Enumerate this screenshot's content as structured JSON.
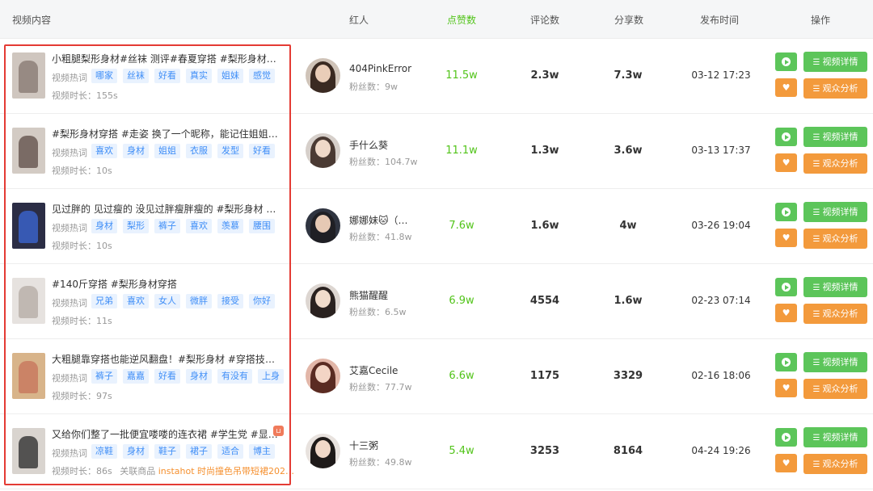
{
  "header": {
    "video": "视频内容",
    "influencer": "红人",
    "likes": "点赞数",
    "comments": "评论数",
    "shares": "分享数",
    "time": "发布时间",
    "ops": "操作"
  },
  "labels": {
    "keywords": "视频热词",
    "duration_prefix": "视频时长：",
    "fans_prefix": "粉丝数：",
    "product_label": "关联商品",
    "detail_btn": "视频详情",
    "analysis_btn": "观众分析"
  },
  "icons": {
    "play": "play-icon",
    "heart": "heart-icon",
    "list": "list-icon",
    "shop": "shopping-bag-icon"
  },
  "colors": {
    "green": "#5cc55a",
    "orange": "#f39a3c",
    "tag_blue": "#3f8ef7",
    "highlight": "#e43b34"
  },
  "rows": [
    {
      "title": "小粗腿梨形身材#丝袜 测评#春夏穿搭 #梨形身材穿搭…",
      "tags": [
        "哪家",
        "丝袜",
        "好看",
        "真实",
        "姐妹",
        "感觉"
      ],
      "duration": "155s",
      "influencer": "404PinkError",
      "fans": "9w",
      "likes": "11.5w",
      "comments": "2.3w",
      "shares": "7.3w",
      "time": "03-12 17:23"
    },
    {
      "title": "#梨形身材穿搭 #走姿 换了一个昵称，能记住姐姐了…",
      "tags": [
        "喜欢",
        "身材",
        "姐姐",
        "衣服",
        "发型",
        "好看"
      ],
      "duration": "10s",
      "influencer": "手什么葵",
      "fans": "104.7w",
      "likes": "11.1w",
      "comments": "1.3w",
      "shares": "3.6w",
      "time": "03-13 17:37"
    },
    {
      "title": "见过胖的 见过瘦的 没见过胖瘦胖瘦的 #梨形身材 #梨…",
      "tags": [
        "身材",
        "梨形",
        "裤子",
        "喜欢",
        "羡慕",
        "腰围"
      ],
      "duration": "10s",
      "influencer": "娜娜妹🐱（…",
      "fans": "41.8w",
      "likes": "7.6w",
      "comments": "1.6w",
      "shares": "4w",
      "time": "03-26 19:04"
    },
    {
      "title": "#140斤穿搭 #梨形身材穿搭",
      "tags": [
        "兄弟",
        "喜欢",
        "女人",
        "微胖",
        "接受",
        "你好"
      ],
      "duration": "11s",
      "influencer": "熊猫醒醒",
      "fans": "6.5w",
      "likes": "6.9w",
      "comments": "4554",
      "shares": "1.6w",
      "time": "02-23 07:14"
    },
    {
      "title": "大粗腿靠穿搭也能逆风翻盘！#梨形身材 #穿搭技巧 …",
      "tags": [
        "裤子",
        "嘉嘉",
        "好看",
        "身材",
        "有没有",
        "上身"
      ],
      "duration": "97s",
      "influencer": "艾嘉Cecile",
      "fans": "77.7w",
      "likes": "6.6w",
      "comments": "1175",
      "shares": "3329",
      "time": "02-16 18:06"
    },
    {
      "title": "又给你们整了一批便宜喽喽的连衣裙 #学生党 #显瘦…",
      "tags": [
        "凉鞋",
        "身材",
        "鞋子",
        "裙子",
        "适合",
        "博主"
      ],
      "duration": "86s",
      "product": "instahot 时尚撞色吊带短裙202…",
      "influencer": "十三粥",
      "fans": "49.8w",
      "likes": "5.4w",
      "comments": "3253",
      "shares": "8164",
      "time": "04-24 19:26"
    }
  ]
}
